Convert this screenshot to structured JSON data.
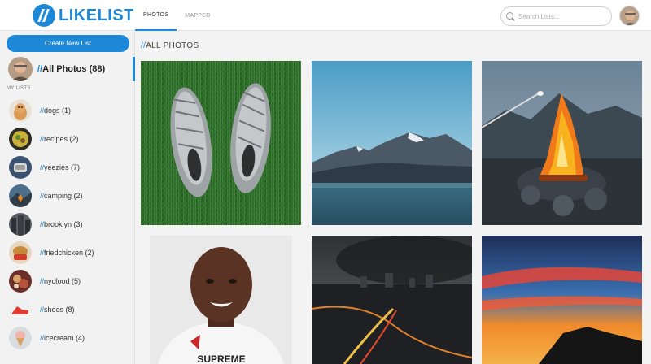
{
  "header": {
    "logo_slashes": "//",
    "logo_text": "LIKELIST",
    "tabs": [
      {
        "label": "PHOTOS",
        "active": true
      },
      {
        "label": "MAPPED",
        "active": false
      }
    ],
    "search_placeholder": "Search Lists..."
  },
  "sidebar": {
    "create_label": "Create New List",
    "all_photos": {
      "slashes": "//",
      "label": "All Photos (88)"
    },
    "mylists_heading": "MY LISTS",
    "items": [
      {
        "slashes": "//",
        "label": "dogs (1)"
      },
      {
        "slashes": "//",
        "label": "recipes (2)"
      },
      {
        "slashes": "//",
        "label": "yeezies (7)"
      },
      {
        "slashes": "//",
        "label": "camping (2)"
      },
      {
        "slashes": "//",
        "label": "brooklyn (3)"
      },
      {
        "slashes": "//",
        "label": "friedchicken (2)"
      },
      {
        "slashes": "//",
        "label": "nycfood (5)"
      },
      {
        "slashes": "//",
        "label": "shoes (8)"
      },
      {
        "slashes": "//",
        "label": "icecream (4)"
      }
    ]
  },
  "main": {
    "title_slashes": "//",
    "title": "ALL PHOTOS",
    "photos": [
      {
        "subject": "sneakers on grass"
      },
      {
        "subject": "mountains over lake"
      },
      {
        "subject": "campfire at dusk"
      },
      {
        "subject": "portrait of man"
      },
      {
        "subject": "stormy city highway"
      },
      {
        "subject": "sunset over island"
      }
    ],
    "shirt_text": "SUPREME"
  },
  "colors": {
    "accent": "#1e88d8",
    "background": "#f3f3f3"
  }
}
